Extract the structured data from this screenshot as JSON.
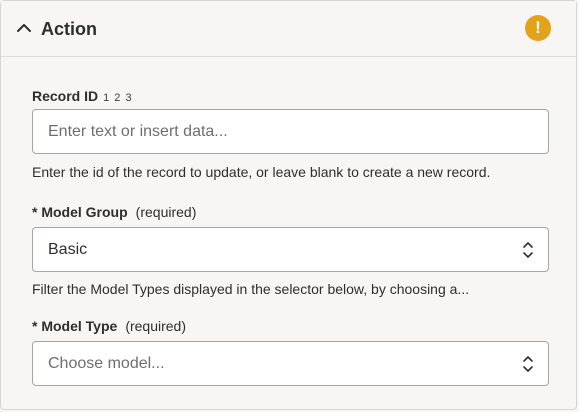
{
  "section": {
    "title": "Action",
    "collapse_icon": "chevron-up-icon",
    "status_icon": "warning-icon",
    "status_glyph": "!",
    "status_color": "#e3a21a"
  },
  "fields": {
    "record_id": {
      "label": "Record ID",
      "type_hint": "1 2 3",
      "placeholder": "Enter text or insert data...",
      "value": "",
      "help": "Enter the id of the record to update, or leave blank to create a new record."
    },
    "model_group": {
      "label": "* Model Group",
      "required_text": "(required)",
      "value": "Basic",
      "help": "Filter the Model Types displayed in the selector below, by choosing a..."
    },
    "model_type": {
      "label": "* Model Type",
      "required_text": "(required)",
      "placeholder": "Choose model..."
    }
  }
}
